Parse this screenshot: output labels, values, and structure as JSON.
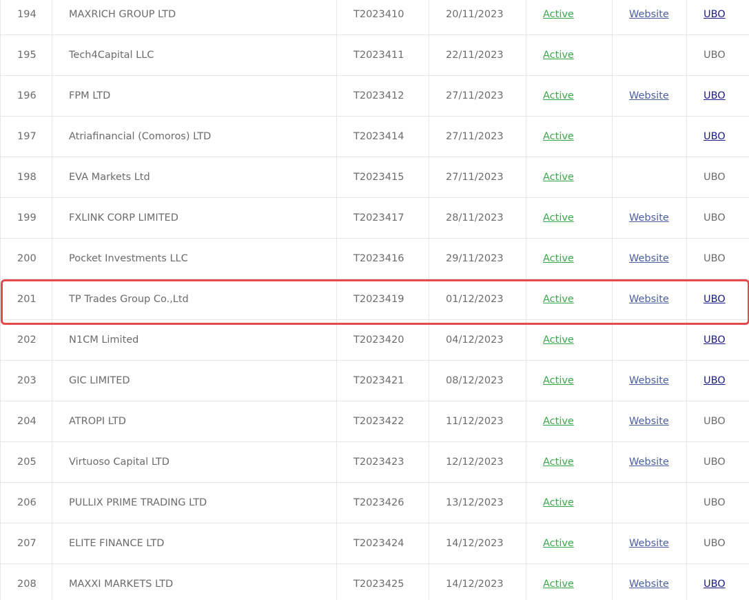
{
  "rows": [
    {
      "num": "194",
      "name": "MAXRICH GROUP LTD",
      "license": "T2023410",
      "date": "20/11/2023",
      "status": "Active",
      "website": "Website",
      "ubo": "UBO",
      "ubo_link": true
    },
    {
      "num": "195",
      "name": "Tech4Capital LLC",
      "license": "T2023411",
      "date": "22/11/2023",
      "status": "Active",
      "website": "",
      "ubo": "UBO",
      "ubo_link": false
    },
    {
      "num": "196",
      "name": "FPM LTD",
      "license": "T2023412",
      "date": "27/11/2023",
      "status": "Active",
      "website": "Website",
      "ubo": "UBO",
      "ubo_link": true
    },
    {
      "num": "197",
      "name": "Atriafinancial (Comoros) LTD",
      "license": "T2023414",
      "date": "27/11/2023",
      "status": "Active",
      "website": "",
      "ubo": "UBO",
      "ubo_link": true
    },
    {
      "num": "198",
      "name": "EVA Markets Ltd",
      "license": "T2023415",
      "date": "27/11/2023",
      "status": "Active",
      "website": "",
      "ubo": "UBO",
      "ubo_link": false
    },
    {
      "num": "199",
      "name": "FXLINK CORP LIMITED",
      "license": "T2023417",
      "date": "28/11/2023",
      "status": "Active",
      "website": "Website",
      "ubo": "UBO",
      "ubo_link": false
    },
    {
      "num": "200",
      "name": "Pocket Investments LLC",
      "license": "T2023416",
      "date": "29/11/2023",
      "status": "Active",
      "website": "Website",
      "ubo": "UBO",
      "ubo_link": false
    },
    {
      "num": "201",
      "name": "TP Trades Group Co.,Ltd",
      "license": "T2023419",
      "date": "01/12/2023",
      "status": "Active",
      "website": "Website",
      "ubo": "UBO",
      "ubo_link": true
    },
    {
      "num": "202",
      "name": "N1CM Limited",
      "license": "T2023420",
      "date": "04/12/2023",
      "status": "Active",
      "website": "",
      "ubo": "UBO",
      "ubo_link": true
    },
    {
      "num": "203",
      "name": "GIC LIMITED",
      "license": "T2023421",
      "date": "08/12/2023",
      "status": "Active",
      "website": "Website",
      "ubo": "UBO",
      "ubo_link": true
    },
    {
      "num": "204",
      "name": "ATROPI LTD",
      "license": "T2023422",
      "date": "11/12/2023",
      "status": "Active",
      "website": "Website",
      "ubo": "UBO",
      "ubo_link": false
    },
    {
      "num": "205",
      "name": "Virtuoso Capital LTD",
      "license": "T2023423",
      "date": "12/12/2023",
      "status": "Active",
      "website": "Website",
      "ubo": "UBO",
      "ubo_link": false
    },
    {
      "num": "206",
      "name": "PULLIX PRIME TRADING LTD",
      "license": "T2023426",
      "date": "13/12/2023",
      "status": "Active",
      "website": "",
      "ubo": "UBO",
      "ubo_link": false
    },
    {
      "num": "207",
      "name": "ELITE FINANCE LTD",
      "license": "T2023424",
      "date": "14/12/2023",
      "status": "Active",
      "website": "Website",
      "ubo": "UBO",
      "ubo_link": false
    },
    {
      "num": "208",
      "name": "MAXXI MARKETS LTD",
      "license": "T2023425",
      "date": "14/12/2023",
      "status": "Active",
      "website": "Website",
      "ubo": "UBO",
      "ubo_link": true
    }
  ],
  "colors": {
    "status": "#3aa84a",
    "website_link": "#4a5fa0",
    "ubo_link": "#1a1a8c",
    "highlight_border": "#e5484d"
  }
}
